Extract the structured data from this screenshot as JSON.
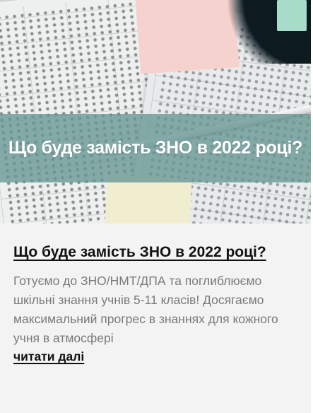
{
  "post": {
    "image_caption": "Що буде замість ЗНО в 2022 році?",
    "title": "Що буде замість ЗНО в 2022 році?",
    "excerpt": "Готуємо до ЗНО/НМТ/ДПА та поглиблюємо шкільні знання учнів 5-11 класів! Досягаємо максимальний прогрес в знаннях для кожного учня в атмосфері",
    "read_more": "читати далі"
  },
  "colors": {
    "banner": "#679692",
    "card_background": "#f3f3f3",
    "title": "#111111",
    "excerpt": "#7a7a7a"
  }
}
